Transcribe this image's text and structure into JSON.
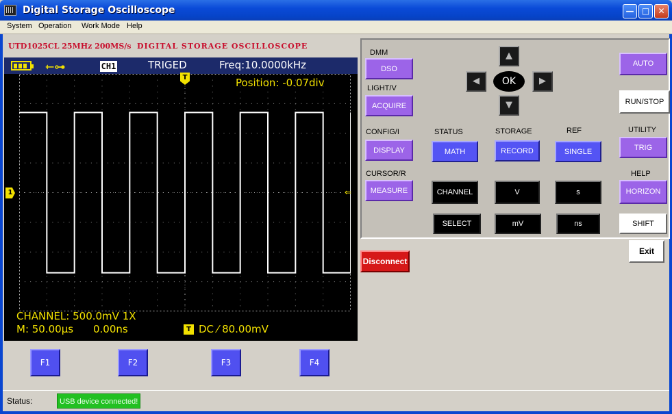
{
  "window": {
    "title": "Digital Storage Oscilloscope",
    "min_glyph": "—",
    "max_glyph": "□",
    "close_glyph": "✕"
  },
  "menu": [
    "System",
    "Operation",
    "Work Mode",
    "Help"
  ],
  "model": {
    "name": "UTD1025CL 25MHz 200MS/s",
    "description": "DIGITAL STORAGE OSCILLOSCOPE"
  },
  "screen": {
    "channel_badge": "CH1",
    "trigger_state": "TRIGED",
    "frequency": "Freq:10.0000kHz",
    "position": "Position: -0.07div",
    "trigger_marker": "T",
    "channel_marker": "1",
    "trigger_level_marker": "⇐",
    "channel_info": "CHANNEL: 500.0mV  1X",
    "timebase": "M: 50.00µs",
    "time_offset": "0.00ns",
    "trigger_badge": "T",
    "trigger_info": "DC  ⁄  80.00mV",
    "waveform": {
      "type": "square",
      "high_div": 2.7,
      "low_div": -2.7,
      "period_div": 2,
      "duty": 0.5,
      "color": "#ffffff"
    },
    "grid_divisions": {
      "x": 12,
      "y": 8
    }
  },
  "function_buttons": [
    "F1",
    "F2",
    "F3",
    "F4"
  ],
  "control": {
    "labels": {
      "dmm": "DMM",
      "light": "LIGHT/V",
      "config": "CONFIG/I",
      "cursor": "CURSOR/R",
      "status": "STATUS",
      "storage": "STORAGE",
      "ref": "REF",
      "utility": "UTILITY",
      "help": "HELP"
    },
    "buttons": {
      "dso": "DSO",
      "acquire": "ACQUIRE",
      "display": "DISPLAY",
      "measure": "MEASURE",
      "math": "MATH",
      "record": "RECORD",
      "single": "SINGLE",
      "auto": "AUTO",
      "run_stop": "RUN/STOP",
      "trig": "TRIG",
      "horizon": "HORIZON",
      "shift": "SHIFT",
      "channel": "CHANNEL",
      "v": "V",
      "s": "s",
      "select": "SELECT",
      "mv": "mV",
      "ns": "ns",
      "ok": "OK"
    },
    "arrows": {
      "up": "▲",
      "down": "▼",
      "left": "◀",
      "right": "▶"
    }
  },
  "disconnect": "Disconnect",
  "exit": "Exit",
  "status": {
    "label": "Status:",
    "value": "USB device connected!"
  },
  "colors": {
    "screen_text": "#f2e100",
    "purple_button": "#9c64e8",
    "blue_button": "#5454f4",
    "disconnect": "#d61818",
    "status_ok": "#22c022"
  }
}
